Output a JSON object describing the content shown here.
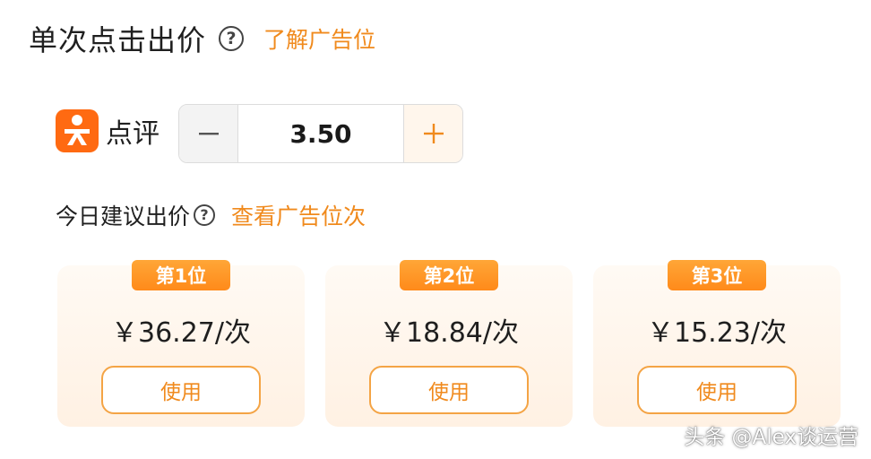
{
  "header": {
    "title": "单次点击出价",
    "help_glyph": "?",
    "link": "了解广告位",
    "help_icon": "question-circle-icon"
  },
  "platform": {
    "name": "点评",
    "logo_icon": "dianping-logo-icon",
    "logo_color": "#ff6a12"
  },
  "bid_stepper": {
    "value": "3.50",
    "minus_icon": "minus-icon",
    "plus_icon": "plus-icon"
  },
  "suggestion": {
    "label": "今日建议出价",
    "help_glyph": "?",
    "link": "查看广告位次"
  },
  "positions": [
    {
      "rank": "第1位",
      "price": "￥36.27/次",
      "button": "使用"
    },
    {
      "rank": "第2位",
      "price": "￥18.84/次",
      "button": "使用"
    },
    {
      "rank": "第3位",
      "price": "￥15.23/次",
      "button": "使用"
    }
  ],
  "watermark": "头条 @Alex谈运营",
  "colors": {
    "accent": "#f08a1d",
    "badge": "#ff8a1a",
    "card_bg": "#fff4e8"
  }
}
